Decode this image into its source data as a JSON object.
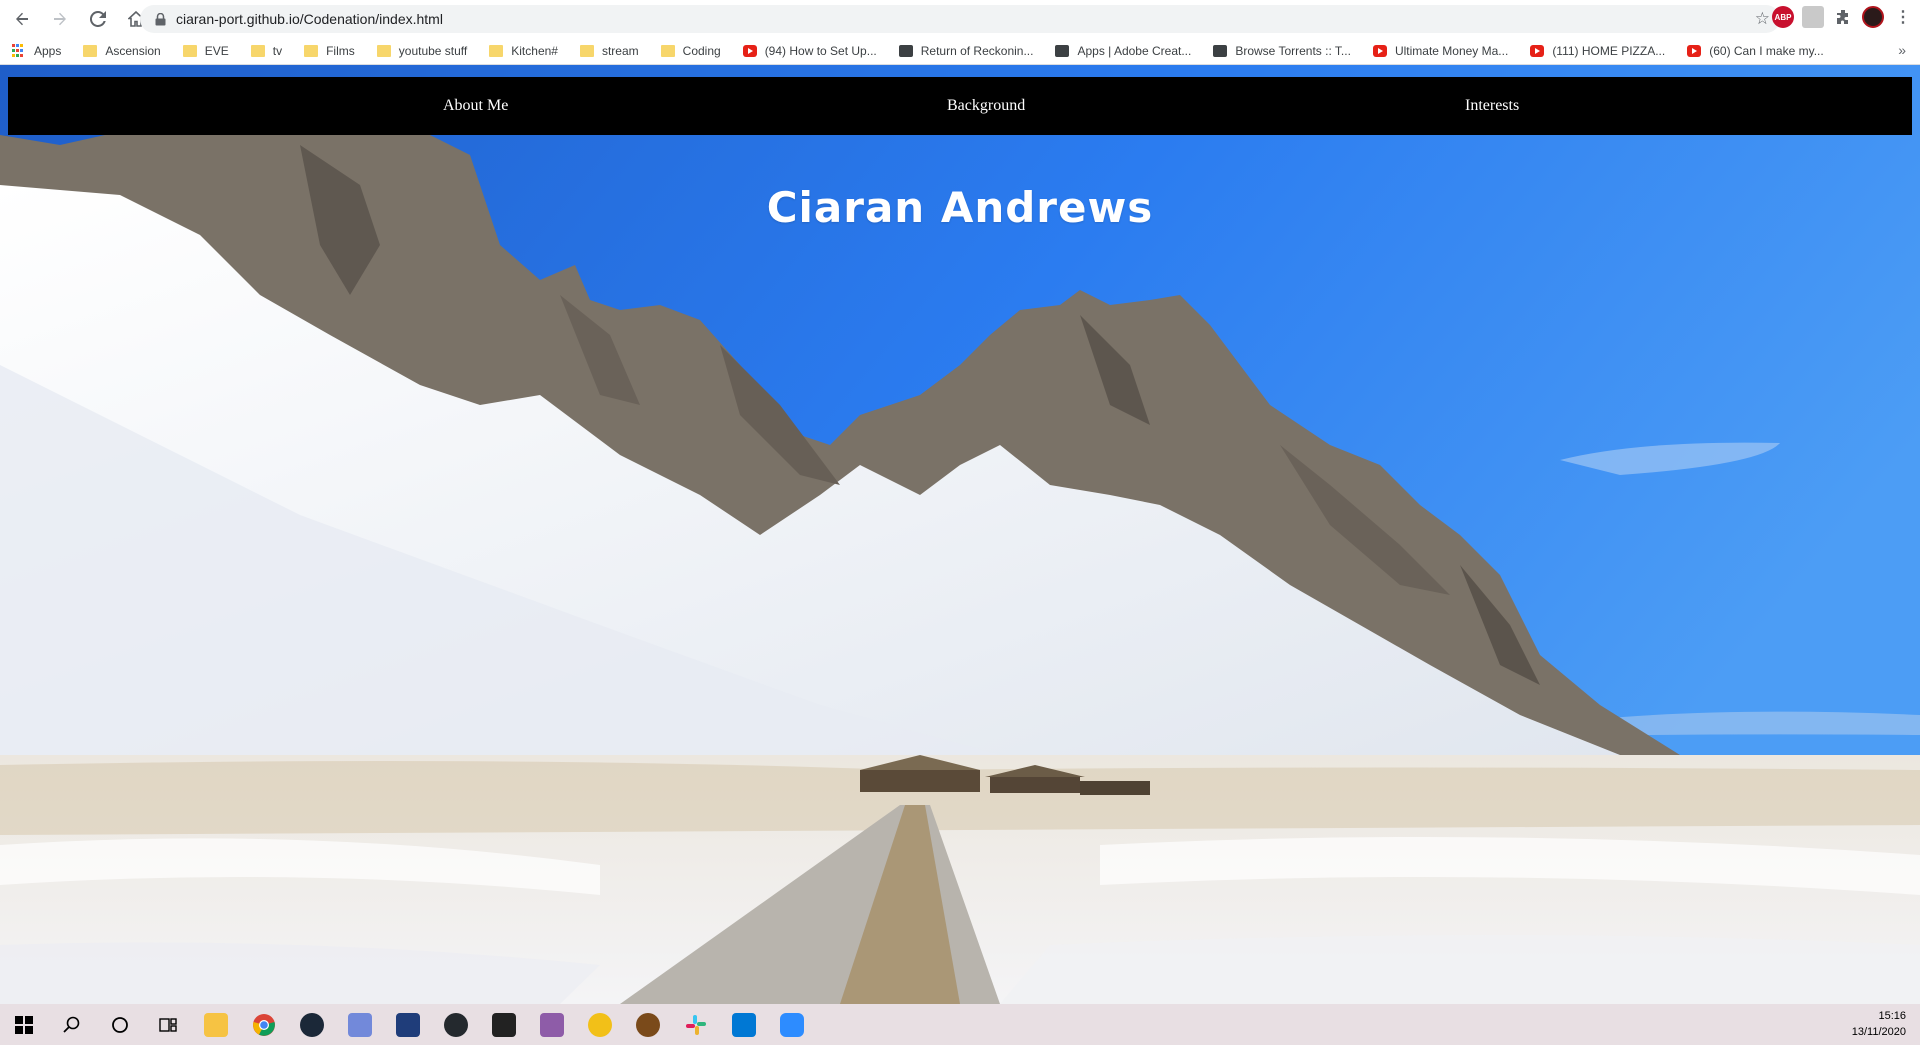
{
  "browser": {
    "url": "ciaran-port.github.io/Codenation/index.html",
    "icons": [
      "back-arrow-icon",
      "forward-arrow-icon",
      "reload-icon",
      "home-icon",
      "lock-icon",
      "star-icon",
      "abp-icon",
      "extension-icon",
      "puzzle-icon",
      "profile-icon",
      "menu-icon"
    ],
    "ext_abp_label": "ABP"
  },
  "bookmarks": [
    {
      "label": "Apps",
      "type": "apps"
    },
    {
      "label": "Ascension",
      "type": "folder"
    },
    {
      "label": "EVE",
      "type": "folder"
    },
    {
      "label": "tv",
      "type": "folder"
    },
    {
      "label": "Films",
      "type": "folder"
    },
    {
      "label": "youtube stuff",
      "type": "folder"
    },
    {
      "label": "Kitchen#",
      "type": "folder"
    },
    {
      "label": "stream",
      "type": "folder"
    },
    {
      "label": "Coding",
      "type": "folder"
    },
    {
      "label": "(94) How to Set Up...",
      "type": "youtube"
    },
    {
      "label": "Return of Reckonin...",
      "type": "site"
    },
    {
      "label": "Apps | Adobe Creat...",
      "type": "site"
    },
    {
      "label": "Browse Torrents :: T...",
      "type": "site"
    },
    {
      "label": "Ultimate Money Ma...",
      "type": "youtube"
    },
    {
      "label": "(111) HOME PIZZA...",
      "type": "youtube"
    },
    {
      "label": "(60) Can I make my...",
      "type": "youtube"
    }
  ],
  "page": {
    "nav": {
      "about": "About Me",
      "background": "Background",
      "interests": "Interests"
    },
    "title": "Ciaran Andrews",
    "colors": {
      "sky": "#2a78e8",
      "nav_bg": "#000000",
      "nav_text": "#ffffff"
    }
  },
  "taskbar": {
    "items": [
      "windows-start-icon",
      "search-icon",
      "cortana-icon",
      "task-view-icon",
      "file-explorer-icon",
      "chrome-icon",
      "steam-icon",
      "discord-icon",
      "app-icon",
      "github-icon",
      "notes-icon",
      "game-icon",
      "bee-icon",
      "overwatch-icon",
      "slack-icon",
      "vscode-icon",
      "zoom-icon"
    ],
    "time": "15:16",
    "date": "13/11/2020"
  }
}
